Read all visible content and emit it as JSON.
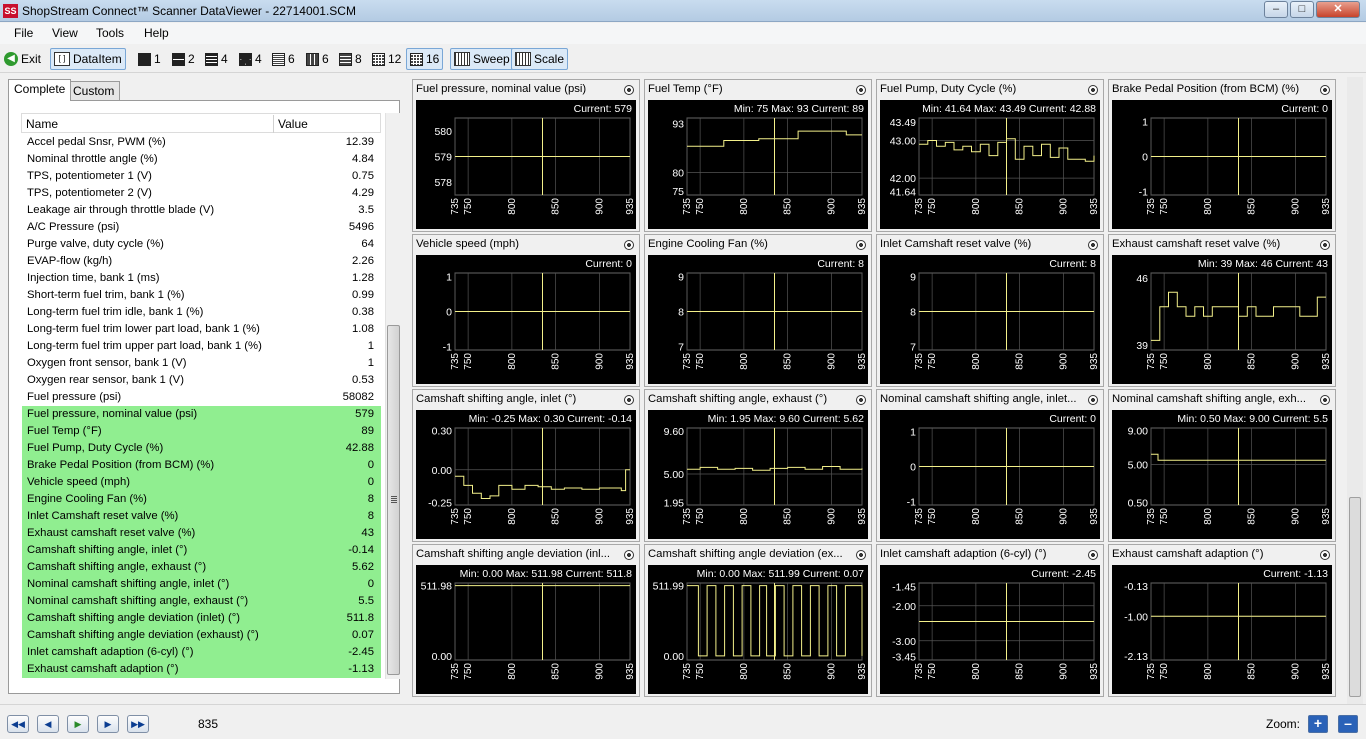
{
  "window": {
    "title": "ShopStream Connect™ Scanner DataViewer - 22714001.SCM"
  },
  "menu": [
    "File",
    "View",
    "Tools",
    "Help"
  ],
  "toolbar": {
    "exit": "Exit",
    "dataitem": "DataItem",
    "layouts": [
      "1",
      "2",
      "4",
      "4",
      "6",
      "6",
      "8",
      "12",
      "16"
    ],
    "sweep": "Sweep",
    "scale": "Scale"
  },
  "tabs": {
    "complete": "Complete",
    "custom": "Custom"
  },
  "list": {
    "header": {
      "name": "Name",
      "value": "Value"
    },
    "rows": [
      {
        "name": "Accel pedal Snsr, PWM (%)",
        "value": "12.39",
        "hl": false
      },
      {
        "name": "Nominal throttle angle (%)",
        "value": "4.84",
        "hl": false
      },
      {
        "name": "TPS, potentiometer 1 (V)",
        "value": "0.75",
        "hl": false
      },
      {
        "name": "TPS, potentiometer 2 (V)",
        "value": "4.29",
        "hl": false
      },
      {
        "name": "Leakage air through throttle blade (V)",
        "value": "3.5",
        "hl": false
      },
      {
        "name": "A/C Pressure (psi)",
        "value": "5496",
        "hl": false
      },
      {
        "name": "Purge valve, duty cycle (%)",
        "value": "64",
        "hl": false
      },
      {
        "name": "EVAP-flow (kg/h)",
        "value": "2.26",
        "hl": false
      },
      {
        "name": "Injection time, bank 1 (ms)",
        "value": "1.28",
        "hl": false
      },
      {
        "name": "Short-term fuel trim, bank 1 (%)",
        "value": "0.99",
        "hl": false
      },
      {
        "name": "Long-term fuel trim idle, bank 1 (%)",
        "value": "0.38",
        "hl": false
      },
      {
        "name": "Long-term fuel trim lower part load, bank 1 (%)",
        "value": "1.08",
        "hl": false
      },
      {
        "name": "Long-term fuel trim upper part load, bank 1 (%)",
        "value": "1",
        "hl": false
      },
      {
        "name": "Oxygen front sensor, bank 1 (V)",
        "value": "1",
        "hl": false
      },
      {
        "name": "Oxygen rear sensor, bank 1 (V)",
        "value": "0.53",
        "hl": false
      },
      {
        "name": "Fuel pressure (psi)",
        "value": "58082",
        "hl": false
      },
      {
        "name": "Fuel pressure, nominal value (psi)",
        "value": "579",
        "hl": true
      },
      {
        "name": "Fuel Temp (°F)",
        "value": "89",
        "hl": true
      },
      {
        "name": "Fuel Pump, Duty Cycle (%)",
        "value": "42.88",
        "hl": true
      },
      {
        "name": "Brake Pedal Position (from BCM) (%)",
        "value": "0",
        "hl": true
      },
      {
        "name": "Vehicle speed (mph)",
        "value": "0",
        "hl": true
      },
      {
        "name": "Engine Cooling Fan (%)",
        "value": "8",
        "hl": true
      },
      {
        "name": "Inlet Camshaft reset valve (%)",
        "value": "8",
        "hl": true
      },
      {
        "name": "Exhaust camshaft reset valve (%)",
        "value": "43",
        "hl": true
      },
      {
        "name": "Camshaft shifting angle, inlet (°)",
        "value": "-0.14",
        "hl": true
      },
      {
        "name": "Camshaft shifting angle, exhaust (°)",
        "value": "5.62",
        "hl": true
      },
      {
        "name": "Nominal camshaft shifting angle, inlet (°)",
        "value": "0",
        "hl": true
      },
      {
        "name": "Nominal camshaft shifting angle, exhaust (°)",
        "value": "5.5",
        "hl": true
      },
      {
        "name": "Camshaft shifting angle deviation (inlet) (°)",
        "value": "511.8",
        "hl": true
      },
      {
        "name": "Camshaft shifting angle deviation (exhaust) (°)",
        "value": "0.07",
        "hl": true
      },
      {
        "name": "Inlet camshaft adaption (6-cyl) (°)",
        "value": "-2.45",
        "hl": true
      },
      {
        "name": "Exhaust camshaft adaption (°)",
        "value": "-1.13",
        "hl": true
      }
    ]
  },
  "chart_data": [
    {
      "type": "line",
      "title": "Fuel pressure, nominal value (psi)",
      "stats": "Current: 579",
      "ticks": [
        "580",
        "579",
        "578"
      ],
      "ylim": [
        577.5,
        580.5
      ],
      "x": [
        735,
        935
      ],
      "y": {
        "kind": "flat",
        "v": 579
      }
    },
    {
      "type": "line",
      "title": "Fuel Temp (°F)",
      "stats": "Min: 75     Max: 93     Current: 89",
      "ticks": [
        "93",
        "80",
        "75"
      ],
      "ylim": [
        74,
        94.5
      ],
      "x": [
        735,
        935
      ],
      "y": {
        "kind": "pts",
        "p": [
          [
            735,
            87
          ],
          [
            775,
            87
          ],
          [
            777,
            88.5
          ],
          [
            815,
            88.5
          ],
          [
            817,
            89
          ],
          [
            860,
            89
          ],
          [
            862,
            91
          ],
          [
            915,
            91
          ],
          [
            917,
            90
          ],
          [
            935,
            90
          ]
        ]
      }
    },
    {
      "type": "line",
      "title": "Fuel Pump, Duty Cycle (%)",
      "stats": "Min: 41.64     Max: 43.49     Current: 42.88",
      "ticks": [
        "43.49",
        "43.00",
        "42.00",
        "41.64"
      ],
      "ylim": [
        41.55,
        43.6
      ],
      "x": [
        735,
        935
      ],
      "y": {
        "kind": "pts",
        "p": [
          [
            735,
            42.9
          ],
          [
            745,
            43.0
          ],
          [
            755,
            42.85
          ],
          [
            765,
            42.95
          ],
          [
            775,
            42.75
          ],
          [
            785,
            42.85
          ],
          [
            795,
            42.7
          ],
          [
            805,
            42.9
          ],
          [
            815,
            42.6
          ],
          [
            825,
            42.95
          ],
          [
            835,
            43.05
          ],
          [
            845,
            42.5
          ],
          [
            855,
            42.85
          ],
          [
            865,
            42.6
          ],
          [
            875,
            42.9
          ],
          [
            885,
            42.55
          ],
          [
            895,
            42.8
          ],
          [
            905,
            42.5
          ],
          [
            915,
            42.5
          ],
          [
            925,
            42.45
          ],
          [
            935,
            42.6
          ]
        ]
      }
    },
    {
      "type": "line",
      "title": "Brake Pedal Position (from BCM) (%)",
      "stats": "Current: 0",
      "ticks": [
        "1",
        "0",
        "-1"
      ],
      "ylim": [
        -1.1,
        1.1
      ],
      "x": [
        735,
        935
      ],
      "y": {
        "kind": "flat",
        "v": 0
      }
    },
    {
      "type": "line",
      "title": "Vehicle speed (mph)",
      "stats": "Current: 0",
      "ticks": [
        "1",
        "0",
        "-1"
      ],
      "ylim": [
        -1.1,
        1.1
      ],
      "x": [
        735,
        935
      ],
      "y": {
        "kind": "flat",
        "v": 0
      }
    },
    {
      "type": "line",
      "title": "Engine Cooling Fan (%)",
      "stats": "Current: 8",
      "ticks": [
        "9",
        "8",
        "7"
      ],
      "ylim": [
        6.9,
        9.1
      ],
      "x": [
        735,
        935
      ],
      "y": {
        "kind": "flat",
        "v": 8
      }
    },
    {
      "type": "line",
      "title": "Inlet Camshaft reset valve (%)",
      "stats": "Current: 8",
      "ticks": [
        "9",
        "8",
        "7"
      ],
      "ylim": [
        6.9,
        9.1
      ],
      "x": [
        735,
        935
      ],
      "y": {
        "kind": "flat",
        "v": 8
      }
    },
    {
      "type": "line",
      "title": "Exhaust camshaft reset valve (%)",
      "stats": "Min: 39     Max: 46     Current: 43",
      "ticks": [
        "46",
        "39"
      ],
      "ylim": [
        38.5,
        46.5
      ],
      "x": [
        735,
        935
      ],
      "y": {
        "kind": "pts",
        "p": [
          [
            735,
            39.5
          ],
          [
            745,
            43
          ],
          [
            755,
            44.5
          ],
          [
            765,
            43
          ],
          [
            775,
            42
          ],
          [
            785,
            43
          ],
          [
            795,
            42
          ],
          [
            805,
            43
          ],
          [
            825,
            43
          ],
          [
            835,
            42
          ],
          [
            845,
            43
          ],
          [
            855,
            42
          ],
          [
            875,
            43
          ],
          [
            905,
            42
          ],
          [
            925,
            44
          ],
          [
            935,
            44
          ]
        ]
      }
    },
    {
      "type": "line",
      "title": "Camshaft shifting angle, inlet (°)",
      "stats": "Min: -0.25     Max: 0.30     Current: -0.14",
      "ticks": [
        "0.30",
        "0.00",
        "-0.25"
      ],
      "ylim": [
        -0.27,
        0.32
      ],
      "x": [
        735,
        935
      ],
      "y": {
        "kind": "pts",
        "p": [
          [
            735,
            -0.05
          ],
          [
            745,
            -0.12
          ],
          [
            755,
            -0.18
          ],
          [
            765,
            -0.22
          ],
          [
            775,
            -0.2
          ],
          [
            785,
            -0.12
          ],
          [
            800,
            -0.15
          ],
          [
            815,
            -0.12
          ],
          [
            830,
            -0.13
          ],
          [
            845,
            -0.15
          ],
          [
            860,
            -0.14
          ],
          [
            880,
            -0.15
          ],
          [
            900,
            -0.14
          ],
          [
            915,
            -0.14
          ],
          [
            925,
            -0.16
          ],
          [
            930,
            0.0
          ],
          [
            935,
            0.0
          ]
        ]
      }
    },
    {
      "type": "line",
      "title": "Camshaft shifting angle, exhaust (°)",
      "stats": "Min: 1.95     Max: 9.60     Current: 5.62",
      "ticks": [
        "9.60",
        "5.00",
        "1.95"
      ],
      "ylim": [
        1.7,
        9.9
      ],
      "x": [
        735,
        935
      ],
      "y": {
        "kind": "pts",
        "p": [
          [
            735,
            5.5
          ],
          [
            750,
            5.7
          ],
          [
            770,
            5.5
          ],
          [
            790,
            5.6
          ],
          [
            810,
            5.4
          ],
          [
            830,
            5.6
          ],
          [
            850,
            5.7
          ],
          [
            870,
            5.5
          ],
          [
            890,
            5.8
          ],
          [
            910,
            5.5
          ],
          [
            935,
            5.6
          ]
        ]
      }
    },
    {
      "type": "line",
      "title": "Nominal camshaft shifting angle, inlet...",
      "stats": "Current: 0",
      "ticks": [
        "1",
        "0",
        "-1"
      ],
      "ylim": [
        -1.1,
        1.1
      ],
      "x": [
        735,
        935
      ],
      "y": {
        "kind": "flat",
        "v": 0
      }
    },
    {
      "type": "line",
      "title": "Nominal camshaft shifting angle, exh...",
      "stats": "Min: 0.50     Max: 9.00     Current: 5.5",
      "ticks": [
        "9.00",
        "5.00",
        "0.50"
      ],
      "ylim": [
        0.2,
        9.3
      ],
      "x": [
        735,
        935
      ],
      "y": {
        "kind": "pts",
        "p": [
          [
            735,
            6.2
          ],
          [
            742,
            6.2
          ],
          [
            743,
            5.5
          ],
          [
            935,
            5.5
          ]
        ]
      }
    },
    {
      "type": "line",
      "title": "Camshaft shifting angle deviation (inl...",
      "stats": "Min: 0.00     Max: 511.98     Current: 511.8",
      "ticks": [
        "511.98",
        "0.00"
      ],
      "ylim": [
        -30,
        530
      ],
      "x": [
        735,
        935
      ],
      "y": {
        "kind": "pts",
        "p": [
          [
            735,
            511
          ],
          [
            935,
            511
          ]
        ]
      }
    },
    {
      "type": "line",
      "title": "Camshaft shifting angle deviation (ex...",
      "stats": "Min: 0.00     Max: 511.99     Current: 0.07",
      "ticks": [
        "511.99",
        "0.00"
      ],
      "ylim": [
        -30,
        530
      ],
      "x": [
        735,
        935
      ],
      "y": {
        "kind": "square",
        "p": [
          [
            735,
            511
          ],
          [
            748,
            0
          ],
          [
            758,
            511
          ],
          [
            768,
            0
          ],
          [
            778,
            511
          ],
          [
            788,
            0
          ],
          [
            798,
            511
          ],
          [
            808,
            0
          ],
          [
            818,
            511
          ],
          [
            826,
            0
          ],
          [
            836,
            511
          ],
          [
            846,
            0
          ],
          [
            856,
            511
          ],
          [
            866,
            0
          ],
          [
            876,
            511
          ],
          [
            886,
            0
          ],
          [
            896,
            511
          ],
          [
            906,
            0
          ],
          [
            916,
            511
          ],
          [
            935,
            0
          ]
        ]
      }
    },
    {
      "type": "line",
      "title": "Inlet camshaft adaption (6-cyl) (°)",
      "stats": "Current: -2.45",
      "ticks": [
        "-1.45",
        "-2.00",
        "-3.00",
        "-3.45"
      ],
      "ylim": [
        -3.55,
        -1.35
      ],
      "x": [
        735,
        935
      ],
      "y": {
        "kind": "flat",
        "v": -2.45
      }
    },
    {
      "type": "line",
      "title": "Exhaust camshaft adaption (°)",
      "stats": "Current: -1.13",
      "ticks": [
        "-0.13",
        "-1.00",
        "-2.13"
      ],
      "ylim": [
        -2.25,
        -0.05
      ],
      "x": [
        735,
        935
      ],
      "y": {
        "kind": "flat",
        "v": -1.0
      }
    }
  ],
  "xticks": [
    "735",
    "750",
    "800",
    "850",
    "900",
    "935"
  ],
  "cursor_x": 835,
  "bottom": {
    "position": "835",
    "zoom": "Zoom:"
  }
}
